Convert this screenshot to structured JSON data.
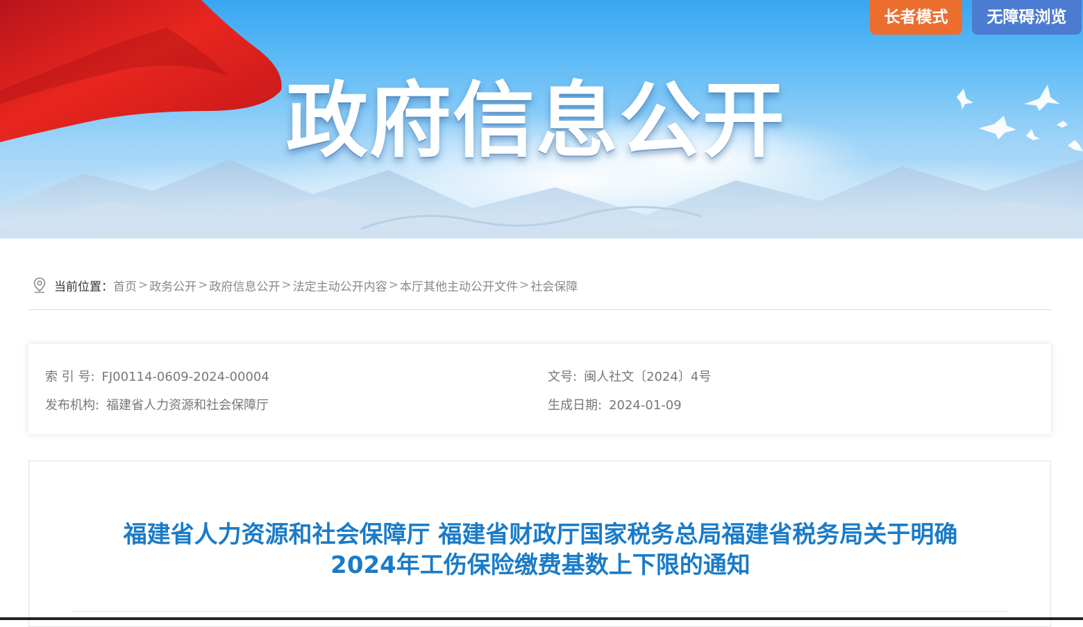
{
  "banner": {
    "title": "政府信息公开",
    "elder_mode_label": "长者模式",
    "accessibility_label": "无障碍浏览"
  },
  "breadcrumb": {
    "label": "当前位置：",
    "items": [
      "首页",
      "政务公开",
      "政府信息公开",
      "法定主动公开内容",
      "本厅其他主动公开文件",
      "社会保障"
    ],
    "separator": ">"
  },
  "meta": {
    "index_label": "索 引 号:",
    "index_value": "FJ00114-0609-2024-00004",
    "doc_no_label": "文号:",
    "doc_no_value": "闽人社文〔2024〕4号",
    "publisher_label": "发布机构:",
    "publisher_value": "福建省人力资源和社会保障厅",
    "date_label": "生成日期:",
    "date_value": "2024-01-09"
  },
  "article": {
    "title_line1": "福建省人力资源和社会保障厅 福建省财政厅国家税务总局福建省税务局关于明确",
    "title_line2": "2024年工伤保险缴费基数上下限的通知"
  },
  "colors": {
    "elder_button": "#ec6e2f",
    "accessibility_button": "#4c7bd2",
    "title_blue": "#1a7bc8"
  }
}
